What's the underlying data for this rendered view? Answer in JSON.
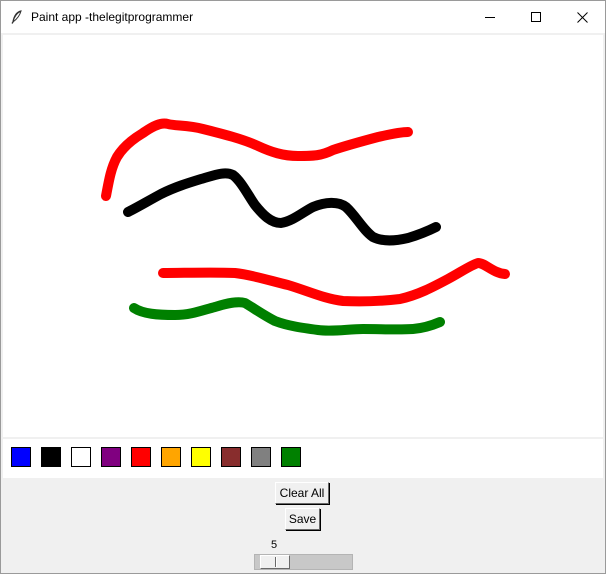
{
  "window": {
    "title": "Paint app -thelegitprogrammer"
  },
  "palette": {
    "colors": [
      "#0000ff",
      "#000000",
      "#ffffff",
      "#800080",
      "#ff0000",
      "#ffa500",
      "#ffff00",
      "#882d2d",
      "#808080",
      "#008000"
    ]
  },
  "strokes": [
    {
      "color": "#ff0000"
    },
    {
      "color": "#000000"
    },
    {
      "color": "#ff0000"
    },
    {
      "color": "#008000"
    }
  ],
  "controls": {
    "clear_label": "Clear All",
    "save_label": "Save",
    "brush_size": 5
  },
  "icons": {
    "app": "feather-icon",
    "minimize": "minimize-icon",
    "maximize": "maximize-icon",
    "close": "close-icon"
  }
}
